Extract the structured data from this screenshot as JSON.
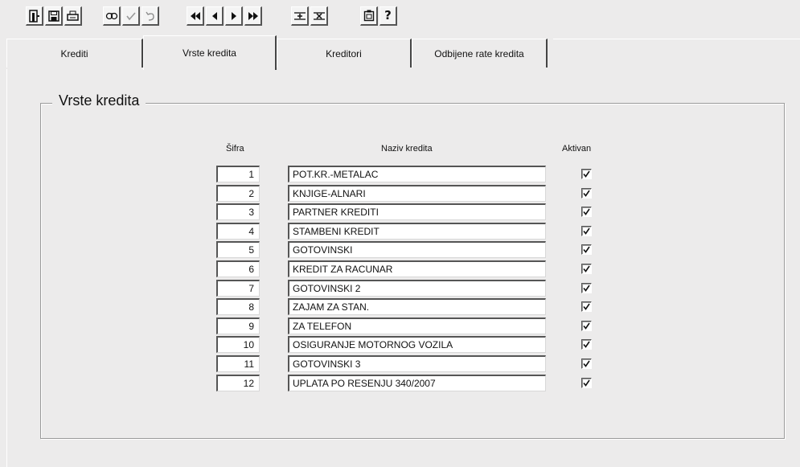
{
  "toolbar": {
    "icons": [
      "exit-icon",
      "save-icon",
      "print-icon",
      "find-icon",
      "accept-icon",
      "undo-icon",
      "first-record-icon",
      "previous-record-icon",
      "next-record-icon",
      "last-record-icon",
      "insert-record-icon",
      "delete-record-icon",
      "copy-icon",
      "help-icon"
    ],
    "help_glyph": "?"
  },
  "tabs": [
    "Krediti",
    "Vrste kredita",
    "Kreditori",
    "Odbijene rate kredita"
  ],
  "active_tab": "Vrste kredita",
  "section": {
    "title": "Vrste kredita",
    "col_code": "Šifra",
    "col_name": "Naziv kredita",
    "col_active": "Aktivan"
  },
  "rows": [
    {
      "code": "1",
      "name": "POT.KR.-METALAC",
      "active": true
    },
    {
      "code": "2",
      "name": "KNJIGE-ALNARI",
      "active": true
    },
    {
      "code": "3",
      "name": "PARTNER KREDITI",
      "active": true
    },
    {
      "code": "4",
      "name": "STAMBENI KREDIT",
      "active": true
    },
    {
      "code": "5",
      "name": "GOTOVINSKI",
      "active": true
    },
    {
      "code": "6",
      "name": "KREDIT ZA RACUNAR",
      "active": true
    },
    {
      "code": "7",
      "name": "GOTOVINSKI 2",
      "active": true
    },
    {
      "code": "8",
      "name": "ZAJAM ZA STAN.",
      "active": true
    },
    {
      "code": "9",
      "name": "ZA TELEFON",
      "active": true
    },
    {
      "code": "10",
      "name": "OSIGURANJE MOTORNOG VOZILA",
      "active": true
    },
    {
      "code": "11",
      "name": "GOTOVINSKI 3",
      "active": true
    },
    {
      "code": "12",
      "name": "UPLATA PO RESENJU 340/2007",
      "active": true
    }
  ]
}
